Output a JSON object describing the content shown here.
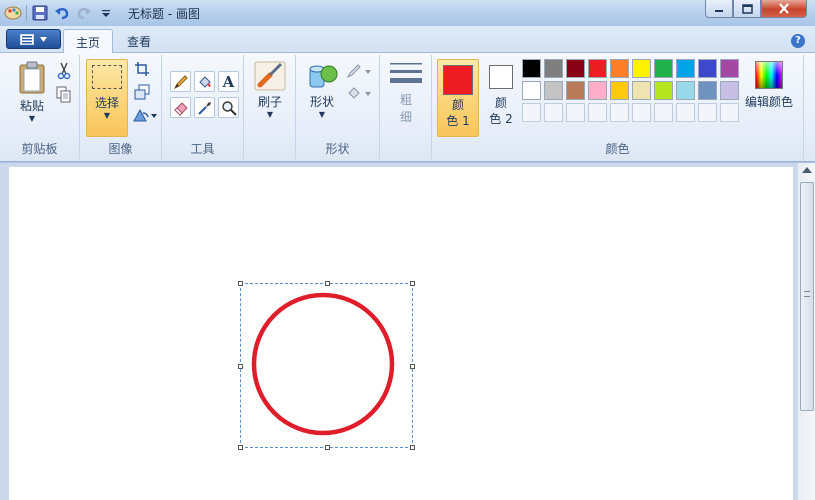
{
  "window": {
    "title": "无标题 - 画图"
  },
  "ribbon_tabs": {
    "home": "主页",
    "view": "查看"
  },
  "help_label": "?",
  "clipboard": {
    "paste_label": "粘贴",
    "group_label": "剪贴板"
  },
  "image": {
    "select_label": "选择",
    "group_label": "图像"
  },
  "tools": {
    "group_label": "工具",
    "text_tool_glyph": "A"
  },
  "brushes": {
    "label": "刷子"
  },
  "shapes": {
    "label": "形状",
    "group_label": "形状"
  },
  "size": {
    "label_line1": "粗",
    "label_line2": "细"
  },
  "colors": {
    "color1_line1": "颜",
    "color1_line2": "色 1",
    "color2_line1": "颜",
    "color2_line2": "色 2",
    "edit_colors_label": "编辑颜色",
    "group_label": "颜色",
    "color1": "#ed1c24",
    "color2": "#ffffff",
    "palette_row1": [
      "#000000",
      "#7f7f7f",
      "#880015",
      "#ed1c24",
      "#ff7f27",
      "#fff200",
      "#22b14c",
      "#00a2e8",
      "#3f48cc",
      "#a349a4"
    ],
    "palette_row2": [
      "#ffffff",
      "#c3c3c3",
      "#b97a57",
      "#ffaec9",
      "#ffc90e",
      "#efe4b0",
      "#b5e61d",
      "#99d9ea",
      "#7092be",
      "#c8bfe7"
    ]
  },
  "canvas": {
    "shape": "circle",
    "stroke_color": "#e01e2b"
  }
}
